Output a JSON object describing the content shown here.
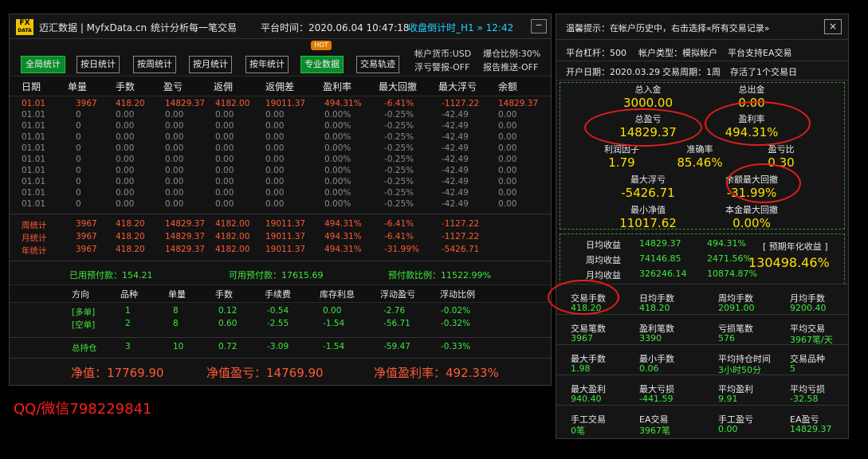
{
  "left": {
    "logo_top": "FX",
    "logo_bottom": "DATA",
    "title": "迈汇数据 | MyfxData.cn",
    "subtitle": "统计分析每一笔交易",
    "platform_time": "平台时间：2020.06.04 10:47:18",
    "countdown": "收盘倒计时_H1 » 12:42",
    "minimize": "−",
    "tabs": [
      "全局统计",
      "按日统计",
      "按周统计",
      "按月统计",
      "按年统计",
      "专业数据",
      "交易轨迹"
    ],
    "hot": "HOT",
    "account_currency": "帐户货币:USD",
    "margin_ratio": "爆仓比例:30%",
    "floating_alert": "浮亏警报-OFF",
    "report_push": "报告推送-OFF",
    "columns": [
      "日期",
      "单量",
      "手数",
      "盈亏",
      "返佣",
      "返佣差",
      "盈利率",
      "最大回撤",
      "最大浮亏",
      "余额"
    ],
    "rows": [
      [
        "01.01",
        "3967",
        "418.20",
        "14829.37",
        "4182.00",
        "19011.37",
        "494.31%",
        "-6.41%",
        "-1127.22",
        "14829.37"
      ],
      [
        "01.01",
        "0",
        "0.00",
        "0.00",
        "0.00",
        "0.00",
        "0.00%",
        "-0.25%",
        "-42.49",
        "0.00"
      ],
      [
        "01.01",
        "0",
        "0.00",
        "0.00",
        "0.00",
        "0.00",
        "0.00%",
        "-0.25%",
        "-42.49",
        "0.00"
      ],
      [
        "01.01",
        "0",
        "0.00",
        "0.00",
        "0.00",
        "0.00",
        "0.00%",
        "-0.25%",
        "-42.49",
        "0.00"
      ],
      [
        "01.01",
        "0",
        "0.00",
        "0.00",
        "0.00",
        "0.00",
        "0.00%",
        "-0.25%",
        "-42.49",
        "0.00"
      ],
      [
        "01.01",
        "0",
        "0.00",
        "0.00",
        "0.00",
        "0.00",
        "0.00%",
        "-0.25%",
        "-42.49",
        "0.00"
      ],
      [
        "01.01",
        "0",
        "0.00",
        "0.00",
        "0.00",
        "0.00",
        "0.00%",
        "-0.25%",
        "-42.49",
        "0.00"
      ],
      [
        "01.01",
        "0",
        "0.00",
        "0.00",
        "0.00",
        "0.00",
        "0.00%",
        "-0.25%",
        "-42.49",
        "0.00"
      ],
      [
        "01.01",
        "0",
        "0.00",
        "0.00",
        "0.00",
        "0.00",
        "0.00%",
        "-0.25%",
        "-42.49",
        "0.00"
      ],
      [
        "01.01",
        "0",
        "0.00",
        "0.00",
        "0.00",
        "0.00",
        "0.00%",
        "-0.25%",
        "-42.49",
        "0.00"
      ]
    ],
    "summary": [
      [
        "周统计",
        "3967",
        "418.20",
        "14829.37",
        "4182.00",
        "19011.37",
        "494.31%",
        "-6.41%",
        "-1127.22"
      ],
      [
        "月统计",
        "3967",
        "418.20",
        "14829.37",
        "4182.00",
        "19011.37",
        "494.31%",
        "-6.41%",
        "-1127.22"
      ],
      [
        "年统计",
        "3967",
        "418.20",
        "14829.37",
        "4182.00",
        "19011.37",
        "494.31%",
        "-31.99%",
        "-5426.71"
      ]
    ],
    "prepay_used": "已用预付款：154.21",
    "prepay_avail": "可用预付款：17615.69",
    "prepay_ratio": "预付款比例：11522.99%",
    "pos_columns": [
      "方向",
      "品种",
      "单量",
      "手数",
      "手续费",
      "库存利息",
      "浮动盈亏",
      "浮动比例"
    ],
    "positions": [
      [
        "[多单]",
        "1",
        "8",
        "0.12",
        "-0.54",
        "0.00",
        "-2.76",
        "-0.02%"
      ],
      [
        "[空单]",
        "2",
        "8",
        "0.60",
        "-2.55",
        "-1.54",
        "-56.71",
        "-0.32%"
      ]
    ],
    "total": [
      "总持仓",
      "3",
      "10",
      "0.72",
      "-3.09",
      "-1.54",
      "-59.47",
      "-0.33%"
    ],
    "net_value": "净值：17769.90",
    "net_pl": "净值盈亏：14769.90",
    "net_rate": "净值盈利率：492.33%"
  },
  "right": {
    "tip": "温馨提示：在帐户历史中，右击选择«所有交易记录»",
    "close": "×",
    "leverage": "平台杠杆：500",
    "account_type": "帐户类型：模拟帐户",
    "ea_support": "平台支持EA交易",
    "open_date": "开户日期：2020.03.29",
    "trade_period": "交易周期：1周",
    "stored": "存活了1个交易日",
    "grid": [
      {
        "label": "总入金",
        "value": "3000.00"
      },
      {
        "label": "总出金",
        "value": "0.00"
      },
      {
        "label": "总盈亏",
        "value": "14829.37"
      },
      {
        "label": "盈利率",
        "value": "494.31%"
      },
      {
        "label": "利润因子",
        "value": "1.79"
      },
      {
        "label": "准确率",
        "value": "85.46%"
      },
      {
        "label": "盈亏比",
        "value": "0.30"
      },
      {
        "label": "最大浮亏",
        "value": "-5426.71"
      },
      {
        "label": "余额最大回撤",
        "value": "-31.99%"
      },
      {
        "label": "最小净值",
        "value": "11017.62"
      },
      {
        "label": "本金最大回撤",
        "value": "0.00%"
      }
    ],
    "income": [
      {
        "label": "日均收益",
        "amount": "14829.37",
        "pct": "494.31%"
      },
      {
        "label": "周均收益",
        "amount": "74146.85",
        "pct": "2471.56%"
      },
      {
        "label": "月均收益",
        "amount": "326246.14",
        "pct": "10874.87%"
      }
    ],
    "annual_label": "[ 预期年化收益 ]",
    "annual_value": "130498.46%",
    "stats": [
      [
        {
          "l": "交易手数",
          "v": "418.20"
        },
        {
          "l": "日均手数",
          "v": "418.20"
        },
        {
          "l": "周均手数",
          "v": "2091.00"
        },
        {
          "l": "月均手数",
          "v": "9200.40"
        }
      ],
      [
        {
          "l": "交易笔数",
          "v": "3967"
        },
        {
          "l": "盈利笔数",
          "v": "3390"
        },
        {
          "l": "亏损笔数",
          "v": "576"
        },
        {
          "l": "平均交易",
          "v": "3967笔/天"
        }
      ],
      [
        {
          "l": "最大手数",
          "v": "1.98"
        },
        {
          "l": "最小手数",
          "v": "0.06"
        },
        {
          "l": "平均持仓时间",
          "v": "3小时50分"
        },
        {
          "l": "交易品种",
          "v": "5"
        }
      ],
      [
        {
          "l": "最大盈利",
          "v": "940.40"
        },
        {
          "l": "最大亏损",
          "v": "-441.59"
        },
        {
          "l": "平均盈利",
          "v": "9.91"
        },
        {
          "l": "平均亏损",
          "v": "-32.58"
        }
      ],
      [
        {
          "l": "手工交易",
          "v": "0笔"
        },
        {
          "l": "EA交易",
          "v": "3967笔"
        },
        {
          "l": "手工盈亏",
          "v": "0.00"
        },
        {
          "l": "EA盈亏",
          "v": "14829.37"
        }
      ]
    ]
  },
  "contact": "QQ/微信798229841"
}
